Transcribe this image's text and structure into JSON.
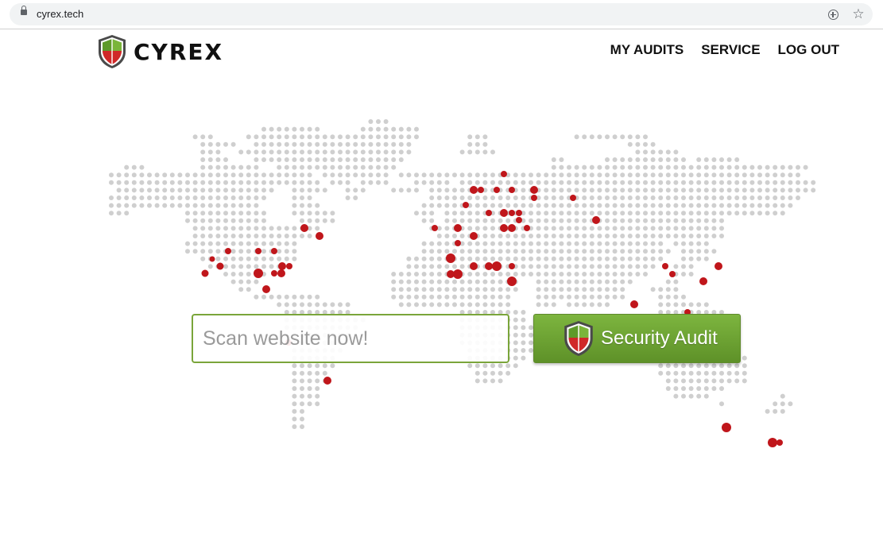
{
  "browser": {
    "url": "cyrex.tech"
  },
  "header": {
    "logo_text": "CYREX",
    "nav": [
      {
        "label": "MY AUDITS"
      },
      {
        "label": "SERVICE"
      },
      {
        "label": "LOG OUT"
      }
    ]
  },
  "search": {
    "placeholder": "Scan website now!",
    "value": ""
  },
  "audit_button": {
    "label": "Security Audit"
  },
  "colors": {
    "brand_green": "#6ea535",
    "brand_red": "#d02828",
    "map_dot": "#cfcfcf",
    "threat_dot": "#c0161b"
  }
}
